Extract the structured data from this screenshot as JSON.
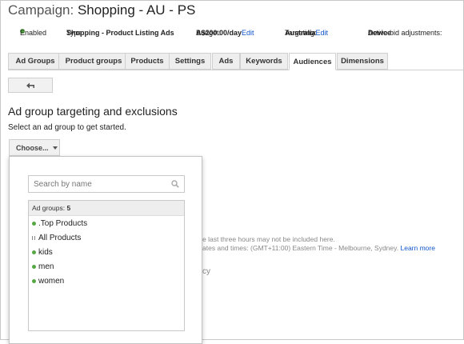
{
  "campaign": {
    "prefix": "Campaign:",
    "name": "Shopping - AU - PS"
  },
  "status": {
    "enabled": "Enabled",
    "type_label": "Type:",
    "type_value": "Shopping - Product Listing Ads",
    "budget_label": "Budget:",
    "budget_value": "A$200.00/day",
    "budget_edit": "Edit",
    "targeting_label": "Targeting:",
    "targeting_value": "Australia",
    "targeting_edit": "Edit",
    "bid_label": "Active bid adjustments:",
    "bid_value": "Device",
    "enabled_color": "#57a845"
  },
  "tabs": [
    {
      "label": "Ad Groups",
      "active": false
    },
    {
      "label": "Product groups",
      "active": false
    },
    {
      "label": "Products",
      "active": false
    },
    {
      "label": "Settings",
      "active": false
    },
    {
      "label": "Ads",
      "active": false
    },
    {
      "label": "Keywords",
      "active": false
    },
    {
      "label": "Audiences",
      "active": true
    },
    {
      "label": "Dimensions",
      "active": false
    }
  ],
  "back_button": {
    "icon": "back-arrow-icon"
  },
  "section": {
    "heading": "Ad group targeting and exclusions",
    "instruction": "Select an ad group to get started.",
    "choose_label": "Choose..."
  },
  "background_text": {
    "line1": "e last three hours may not be included here.",
    "line2": "ates and times: (GMT+11:00) Eastern Time - Melbourne, Sydney.",
    "learn_more": "Learn more",
    "fragment": "cy"
  },
  "dropdown": {
    "search_placeholder": "Search by name",
    "search_icon": "search-icon",
    "list_header_label": "Ad groups:",
    "list_header_count": "5",
    "items": [
      {
        "label": ".Top Products",
        "status": "enabled"
      },
      {
        "label": "All Products",
        "status": "paused"
      },
      {
        "label": "kids",
        "status": "enabled"
      },
      {
        "label": "men",
        "status": "enabled"
      },
      {
        "label": "women",
        "status": "enabled"
      }
    ]
  }
}
